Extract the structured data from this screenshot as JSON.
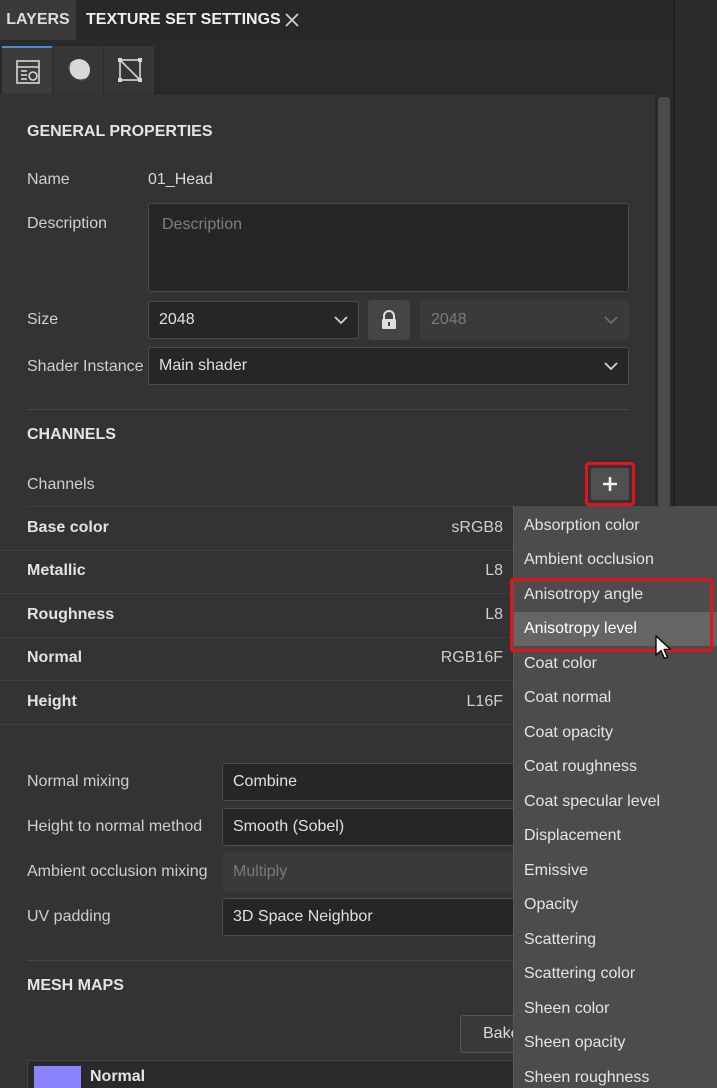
{
  "tabs": {
    "layers": "LAYERS",
    "texture_set_settings": "TEXTURE SET SETTINGS"
  },
  "toolbar_icons": [
    "texture-set-settings-icon",
    "material-sphere-icon",
    "uv-mesh-icon"
  ],
  "general": {
    "title": "GENERAL PROPERTIES",
    "name_label": "Name",
    "name_value": "01_Head",
    "description_label": "Description",
    "description_placeholder": "Description",
    "size_label": "Size",
    "size_value": "2048",
    "size_value_locked": "2048",
    "shader_label": "Shader Instance",
    "shader_value": "Main shader"
  },
  "channels": {
    "title": "CHANNELS",
    "label": "Channels",
    "add_icon": "plus-icon",
    "rows": [
      {
        "name": "Base color",
        "format": "sRGB8"
      },
      {
        "name": "Metallic",
        "format": "L8"
      },
      {
        "name": "Roughness",
        "format": "L8"
      },
      {
        "name": "Normal",
        "format": "RGB16F"
      },
      {
        "name": "Height",
        "format": "L16F"
      }
    ]
  },
  "settings": {
    "normal_mixing_label": "Normal mixing",
    "normal_mixing_value": "Combine",
    "height_to_normal_label": "Height to normal method",
    "height_to_normal_value": "Smooth (Sobel)",
    "ao_mixing_label": "Ambient occlusion mixing",
    "ao_mixing_value": "Multiply",
    "uv_padding_label": "UV padding",
    "uv_padding_value": "3D Space Neighbor"
  },
  "mesh_maps": {
    "title": "MESH MAPS",
    "bake_label": "Bake",
    "first_map": "Normal",
    "first_map_color": "#8a84ff"
  },
  "channel_dropdown": {
    "items": [
      "Absorption color",
      "Ambient occlusion",
      "Anisotropy angle",
      "Anisotropy level",
      "Coat color",
      "Coat normal",
      "Coat opacity",
      "Coat roughness",
      "Coat specular level",
      "Displacement",
      "Emissive",
      "Opacity",
      "Scattering",
      "Scattering color",
      "Sheen color",
      "Sheen opacity",
      "Sheen roughness"
    ],
    "hovered_item": "Anisotropy level",
    "highlight_color": "#e0141c"
  }
}
